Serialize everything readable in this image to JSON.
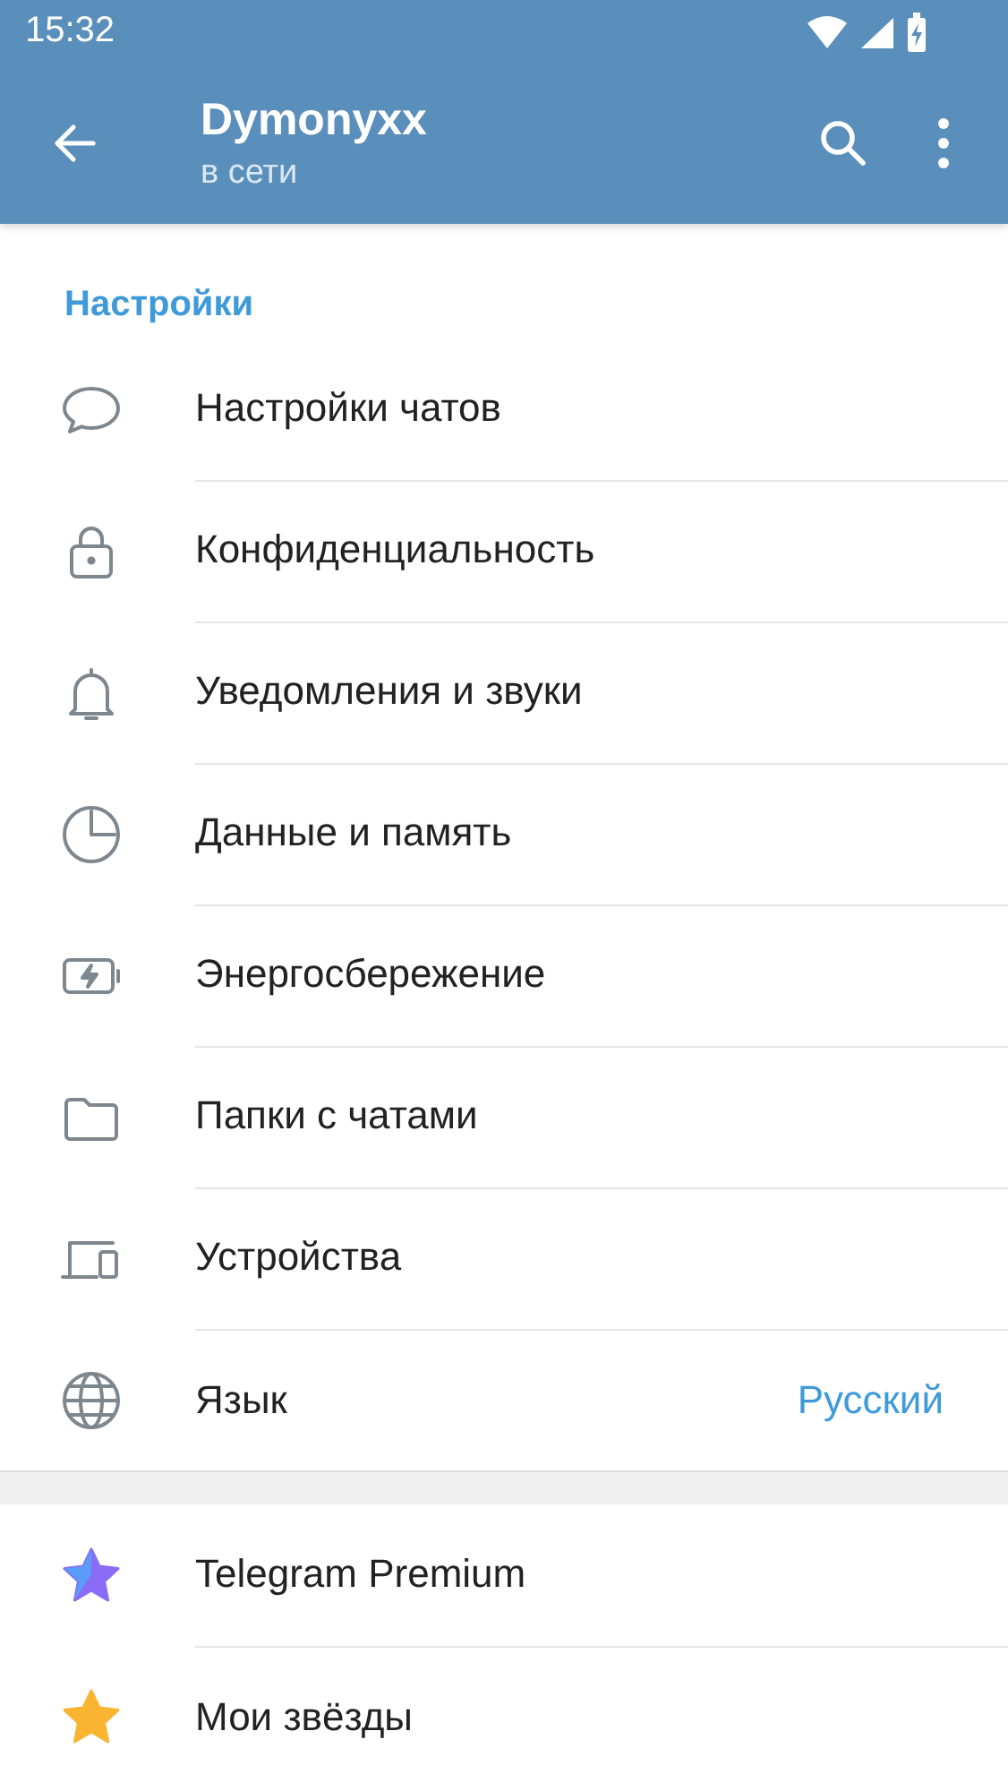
{
  "status_bar": {
    "time": "15:32"
  },
  "toolbar": {
    "title": "Dymonyxx",
    "subtitle": "в сети"
  },
  "sections": [
    {
      "header": "Настройки",
      "items": [
        {
          "kind": "chat",
          "label": "Настройки чатов"
        },
        {
          "kind": "lock",
          "label": "Конфиденциальность"
        },
        {
          "kind": "bell",
          "label": "Уведомления и звуки"
        },
        {
          "kind": "pie",
          "label": "Данные и память"
        },
        {
          "kind": "battery",
          "label": "Энергосбережение"
        },
        {
          "kind": "folder",
          "label": "Папки с чатами"
        },
        {
          "kind": "devices",
          "label": "Устройства"
        },
        {
          "kind": "globe",
          "label": "Язык",
          "value": "Русский"
        }
      ]
    },
    {
      "items": [
        {
          "kind": "premium",
          "label": "Telegram Premium"
        },
        {
          "kind": "stars",
          "label": "Мои звёзды"
        }
      ]
    }
  ]
}
